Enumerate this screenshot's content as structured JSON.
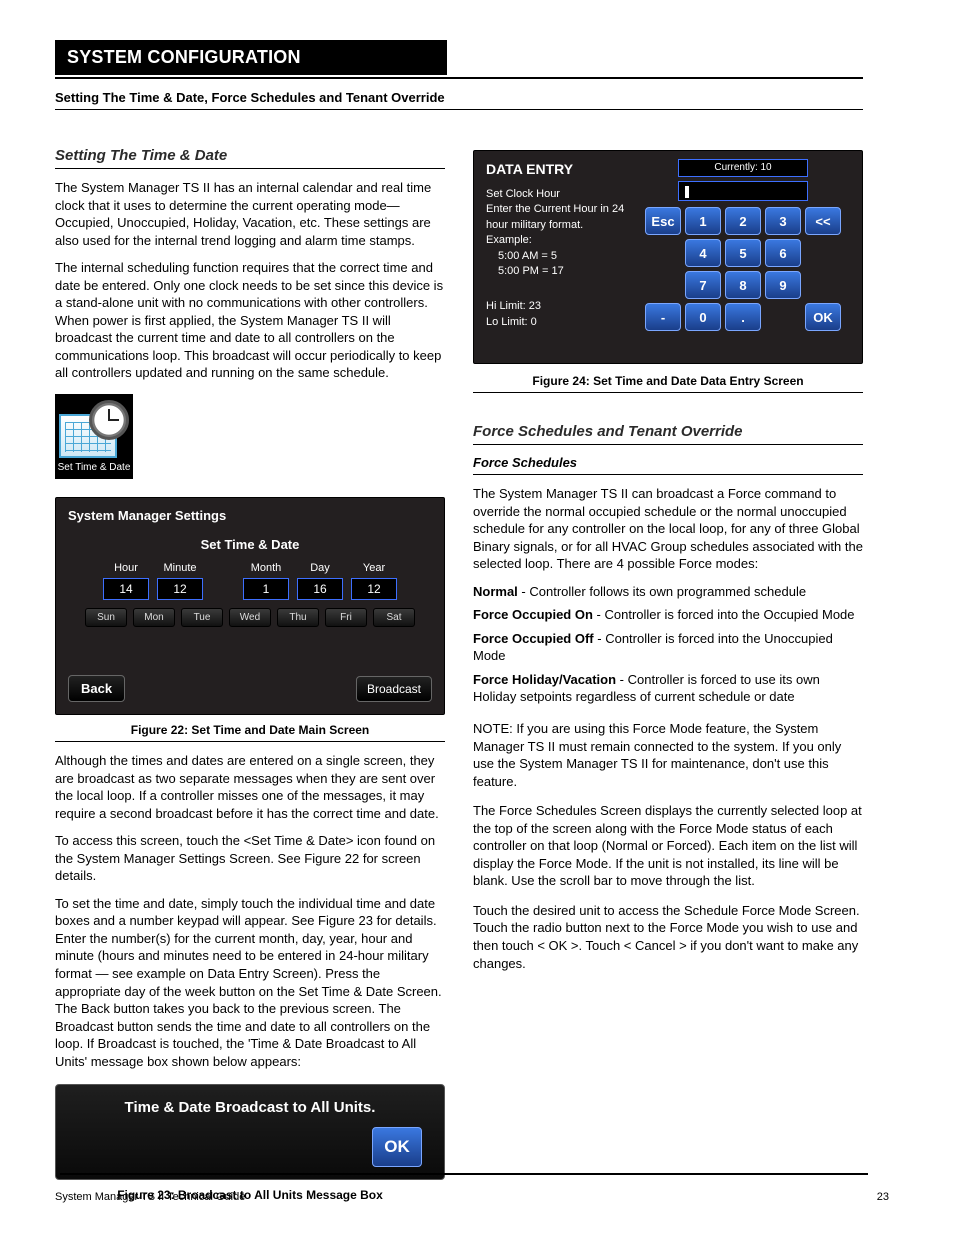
{
  "header": {
    "title_bar": "SYSTEM CONFIGURATION",
    "chapter_line": "Setting The Time & Date, Force Schedules and Tenant Override"
  },
  "left": {
    "subheader": "Setting The Time & Date",
    "para1": "The System Manager TS II has an internal calendar and real time clock that it uses to determine the current operating mode—Occupied, Unoccupied, Holiday, Vacation, etc. These settings are also used for the internal trend logging and alarm time stamps.",
    "para2": "The internal scheduling function requires that the correct time and date be entered. Only one clock needs to be set since this device is a stand-alone unit with no communications with other controllers. When power is first applied, the System Manager TS II will broadcast the current time and date to all controllers on the communications loop. This broadcast will occur periodically to keep all controllers updated and running on the same schedule.",
    "icon_label": "Set Time & Date",
    "fig_panel_title": "Figure 22: Set Time and Date Main Screen",
    "body2": "Although the times and dates are entered on a single screen, they are broadcast as two separate messages when they are sent over the local loop. If a controller misses one of the messages, it may require a second broadcast before it has the correct time and date.",
    "body3": "To access this screen, touch the <Set Time & Date> icon found on the System Manager Settings Screen. See Figure 22 for screen details.",
    "body4": "To set the time and date, simply touch the individual time and date boxes and a number keypad will appear. See Figure 23 for details. Enter the number(s) for the current month, day, year, hour and minute (hours and minutes need to be entered in 24-hour military format — see example on Data Entry Screen). Press the appropriate day of the week button on the Set Time & Date Screen. The Back button takes you back to the previous screen. The Broadcast button sends the time and date to all controllers on the loop. If Broadcast is touched, the 'Time & Date Broadcast to All Units' message box shown below appears:",
    "fig_ok_title": "Figure 23: Broadcast to All Units Message Box"
  },
  "right": {
    "fig_keypad_title": "Figure 24: Set Time and Date Data Entry Screen",
    "sub2": "Force Schedules and Tenant Override",
    "fs_hdr": "Force Schedules",
    "body1": "The System Manager TS II can broadcast a Force command to override the normal occupied schedule or the normal unoccupied schedule for any controller on the local loop, for any of three Global Binary signals, or for all HVAC Group schedules associated with the selected loop. There are 4 possible Force modes:",
    "modes": {
      "normal_lbl": "Normal",
      "normal_txt": "- Controller follows its own programmed schedule",
      "foron_lbl": "Force Occupied On",
      "foron_txt": "- Controller is forced into the Occupied Mode",
      "foroff_lbl": "Force Occupied Off",
      "foroff_txt": "- Controller is forced into the Unoccupied Mode",
      "forvac_lbl": "Force Holiday/Vacation",
      "forvac_txt": "- Controller is forced to use its own Holiday setpoints regardless of current schedule or date"
    },
    "note": "NOTE: If you are using this Force Mode feature, the System Manager TS II must remain connected to the system. If you only use the System Manager TS II for maintenance, don't use this feature.",
    "body3": "The Force Schedules Screen displays the currently selected loop at the top of the screen along with the Force Mode status of each controller on that loop (Normal or Forced). Each item on the list will display the Force Mode. If the unit is not installed, its line will be blank. Use the scroll bar to move through the list.",
    "body4": "Touch the desired unit to access the Schedule Force Mode Screen. Touch the radio button next to the Force Mode you wish to use and then touch < OK >. Touch < Cancel > if you don't want to make any changes."
  },
  "set_time_panel": {
    "title": "System Manager Settings",
    "subtitle": "Set Time & Date",
    "cols": {
      "hour_lbl": "Hour",
      "hour_val": "14",
      "min_lbl": "Minute",
      "min_val": "12",
      "month_lbl": "Month",
      "month_val": "1",
      "day_lbl": "Day",
      "day_val": "16",
      "year_lbl": "Year",
      "year_val": "12"
    },
    "days": [
      "Sun",
      "Mon",
      "Tue",
      "Wed",
      "Thu",
      "Fri",
      "Sat"
    ],
    "back": "Back",
    "broadcast": "Broadcast"
  },
  "data_entry": {
    "title": "DATA ENTRY",
    "line1": "Set Clock Hour",
    "line2": "Enter the Current Hour in 24 hour military format.",
    "line3": "Example:",
    "ex1": "5:00 AM =   5",
    "ex2": "5:00 PM = 17",
    "hi": "Hi Limit:  23",
    "lo": "Lo Limit:   0",
    "currently": "Currently: 10",
    "keys": {
      "esc": "Esc",
      "k1": "1",
      "k2": "2",
      "k3": "3",
      "bksp": "<<",
      "k4": "4",
      "k5": "5",
      "k6": "6",
      "k7": "7",
      "k8": "8",
      "k9": "9",
      "neg": "-",
      "k0": "0",
      "dot": ".",
      "ok": "OK"
    }
  },
  "okdlg": {
    "msg": "Time & Date Broadcast to All Units.",
    "ok": "OK"
  },
  "footer": {
    "left": "System Manager TS II Technical Guide",
    "right": "23"
  }
}
